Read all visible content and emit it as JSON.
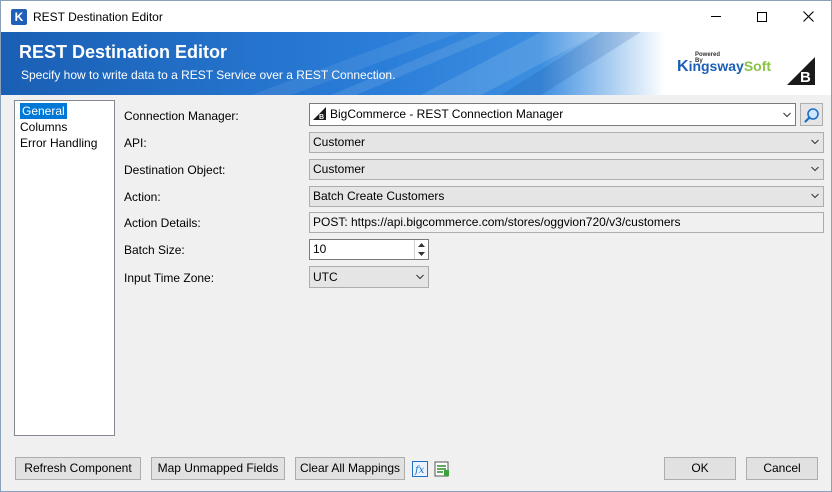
{
  "window": {
    "title": "REST Destination Editor",
    "app_icon": "K"
  },
  "banner": {
    "title": "REST Destination Editor",
    "subtitle": "Specify how to write data to a REST Service over a REST Connection.",
    "logo_powered": "Powered By",
    "logo_k": "K",
    "logo_ingsway": "ingsway",
    "logo_soft": "Soft"
  },
  "nav": {
    "items": [
      {
        "label": "General",
        "selected": true
      },
      {
        "label": "Columns",
        "selected": false
      },
      {
        "label": "Error Handling",
        "selected": false
      }
    ]
  },
  "form": {
    "connection_manager": {
      "label": "Connection Manager:",
      "value": "BigCommerce - REST Connection Manager"
    },
    "api": {
      "label": "API:",
      "value": "Customer"
    },
    "destination_object": {
      "label": "Destination Object:",
      "value": "Customer"
    },
    "action": {
      "label": "Action:",
      "value": "Batch Create Customers"
    },
    "action_details": {
      "label": "Action Details:",
      "value": "POST: https://api.bigcommerce.com/stores/oggvion720/v3/customers"
    },
    "batch_size": {
      "label": "Batch Size:",
      "value": "10"
    },
    "input_time_zone": {
      "label": "Input Time Zone:",
      "value": "UTC"
    }
  },
  "buttons": {
    "refresh": "Refresh Component",
    "map_unmapped": "Map Unmapped Fields",
    "clear_mappings": "Clear All Mappings",
    "ok": "OK",
    "cancel": "Cancel"
  },
  "colors": {
    "accent": "#0078d7",
    "banner_blue": "#1a5fb4",
    "kingsway_green": "#8bc34a"
  },
  "icons": [
    "kingswaysoft-app-icon",
    "minimize-icon",
    "maximize-icon",
    "close-icon",
    "bigcommerce-logo-icon",
    "search-icon",
    "chevron-down-icon",
    "expression-fx-icon",
    "sheet-edit-icon"
  ]
}
